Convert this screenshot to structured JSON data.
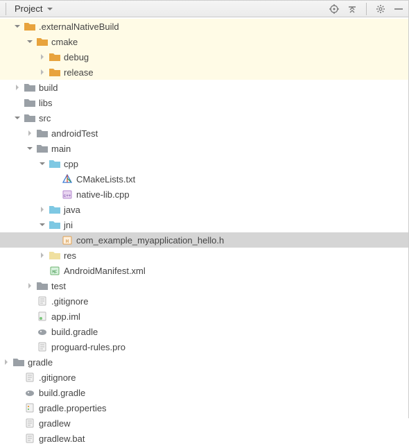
{
  "toolbar": {
    "title": "Project"
  },
  "tree": {
    "externalNativeBuild": {
      "label": ".externalNativeBuild"
    },
    "cmake": {
      "label": "cmake"
    },
    "debug": {
      "label": "debug"
    },
    "release": {
      "label": "release"
    },
    "build": {
      "label": "build"
    },
    "libs": {
      "label": "libs"
    },
    "src": {
      "label": "src"
    },
    "androidTest": {
      "label": "androidTest"
    },
    "main": {
      "label": "main"
    },
    "cpp": {
      "label": "cpp"
    },
    "cmakelists": {
      "label": "CMakeLists.txt"
    },
    "nativelib": {
      "label": "native-lib.cpp"
    },
    "java": {
      "label": "java"
    },
    "jni": {
      "label": "jni"
    },
    "helloh": {
      "label": "com_example_myapplication_hello.h"
    },
    "res": {
      "label": "res"
    },
    "manifest": {
      "label": "AndroidManifest.xml"
    },
    "test": {
      "label": "test"
    },
    "gitignore1": {
      "label": ".gitignore"
    },
    "appiml": {
      "label": "app.iml"
    },
    "buildgradle1": {
      "label": "build.gradle"
    },
    "proguard": {
      "label": "proguard-rules.pro"
    },
    "gradle": {
      "label": "gradle"
    },
    "gitignore2": {
      "label": ".gitignore"
    },
    "buildgradle2": {
      "label": "build.gradle"
    },
    "gradleprops": {
      "label": "gradle.properties"
    },
    "gradlew": {
      "label": "gradlew"
    },
    "gradlewbat": {
      "label": "gradlew.bat"
    }
  }
}
